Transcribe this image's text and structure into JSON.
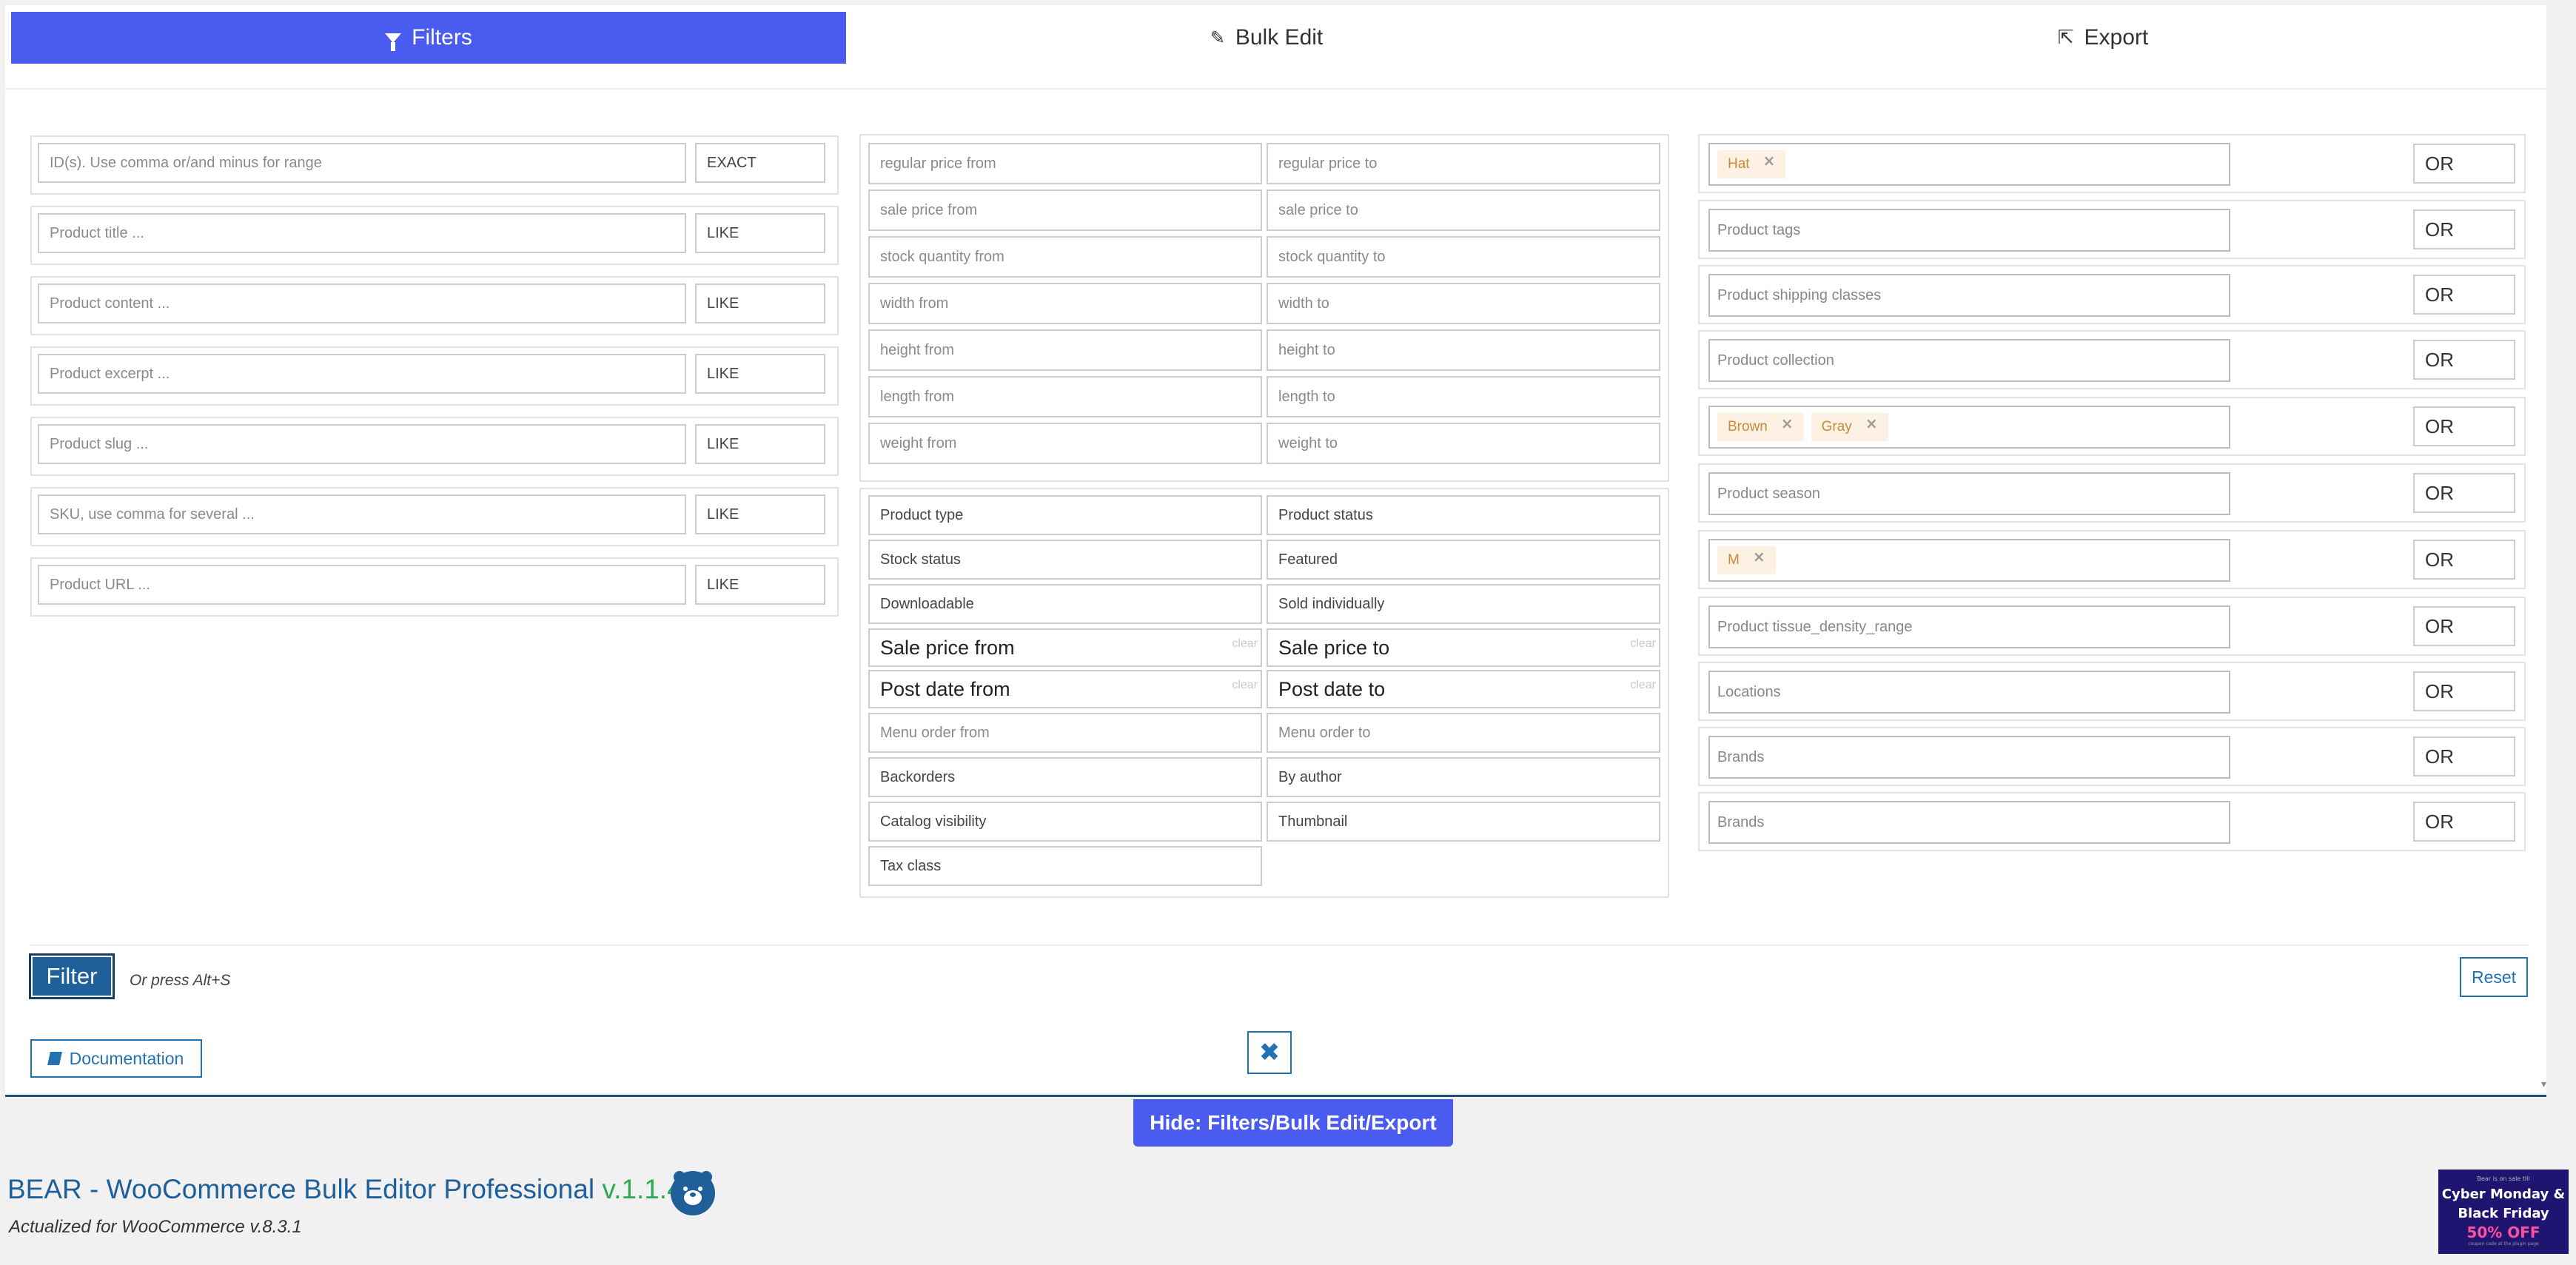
{
  "tabs": [
    {
      "label": "Filters",
      "icon": "filter-icon",
      "active": true
    },
    {
      "label": "Bulk Edit",
      "icon": "pencil-icon",
      "active": false
    },
    {
      "label": "Export",
      "icon": "export-icon",
      "active": false
    }
  ],
  "text_filters": [
    {
      "placeholder": "ID(s). Use comma or/and minus for range",
      "mode": "EXACT"
    },
    {
      "placeholder": "Product title ...",
      "mode": "LIKE"
    },
    {
      "placeholder": "Product content ...",
      "mode": "LIKE"
    },
    {
      "placeholder": "Product excerpt ...",
      "mode": "LIKE"
    },
    {
      "placeholder": "Product slug ...",
      "mode": "LIKE"
    },
    {
      "placeholder": "SKU, use comma for several ...",
      "mode": "LIKE"
    },
    {
      "placeholder": "Product URL ...",
      "mode": "LIKE"
    }
  ],
  "range_filters": [
    {
      "from": "regular price from",
      "to": "regular price to"
    },
    {
      "from": "sale price from",
      "to": "sale price to"
    },
    {
      "from": "stock quantity from",
      "to": "stock quantity to"
    },
    {
      "from": "width from",
      "to": "width to"
    },
    {
      "from": "height from",
      "to": "height to"
    },
    {
      "from": "length from",
      "to": "length to"
    },
    {
      "from": "weight from",
      "to": "weight to"
    }
  ],
  "select_filters": {
    "product_type": "Product type",
    "product_status": "Product status",
    "stock_status": "Stock status",
    "featured": "Featured",
    "downloadable": "Downloadable",
    "sold_individually": "Sold individually",
    "sale_price_from": "Sale price from",
    "sale_price_to": "Sale price to",
    "post_date_from": "Post date from",
    "post_date_to": "Post date to",
    "clear_label": "clear",
    "menu_order_from": "Menu order from",
    "menu_order_to": "Menu order to",
    "backorders": "Backorders",
    "by_author": "By author",
    "catalog_visibility": "Catalog visibility",
    "thumbnail": "Thumbnail",
    "tax_class": "Tax class"
  },
  "taxonomy_filters": {
    "logic_label": "OR",
    "tags_cat": [
      "Hat"
    ],
    "product_tags": "Product tags",
    "shipping_classes": "Product shipping classes",
    "collection": "Product collection",
    "colors": [
      "Brown",
      "Gray"
    ],
    "season": "Product season",
    "sizes": [
      "M"
    ],
    "tissue": "Product tissue_density_range",
    "locations": "Locations",
    "brands1": "Brands",
    "brands2": "Brands"
  },
  "actions": {
    "filter_label": "Filter",
    "hint": "Or press Alt+S",
    "reset_label": "Reset",
    "documentation_label": "Documentation",
    "hide_label": "Hide: Filters/Bulk Edit/Export"
  },
  "footer": {
    "title": "BEAR - WooCommerce Bulk Editor Professional",
    "version": "v.1.1.4",
    "subtitle": "Actualized for WooCommerce v.8.3.1"
  },
  "promo": {
    "small": "Bear is on sale till",
    "headline1": "Cyber Monday &",
    "headline2": "Black Friday",
    "off": "50% OFF",
    "foot": "coupon code at the plugin page"
  }
}
